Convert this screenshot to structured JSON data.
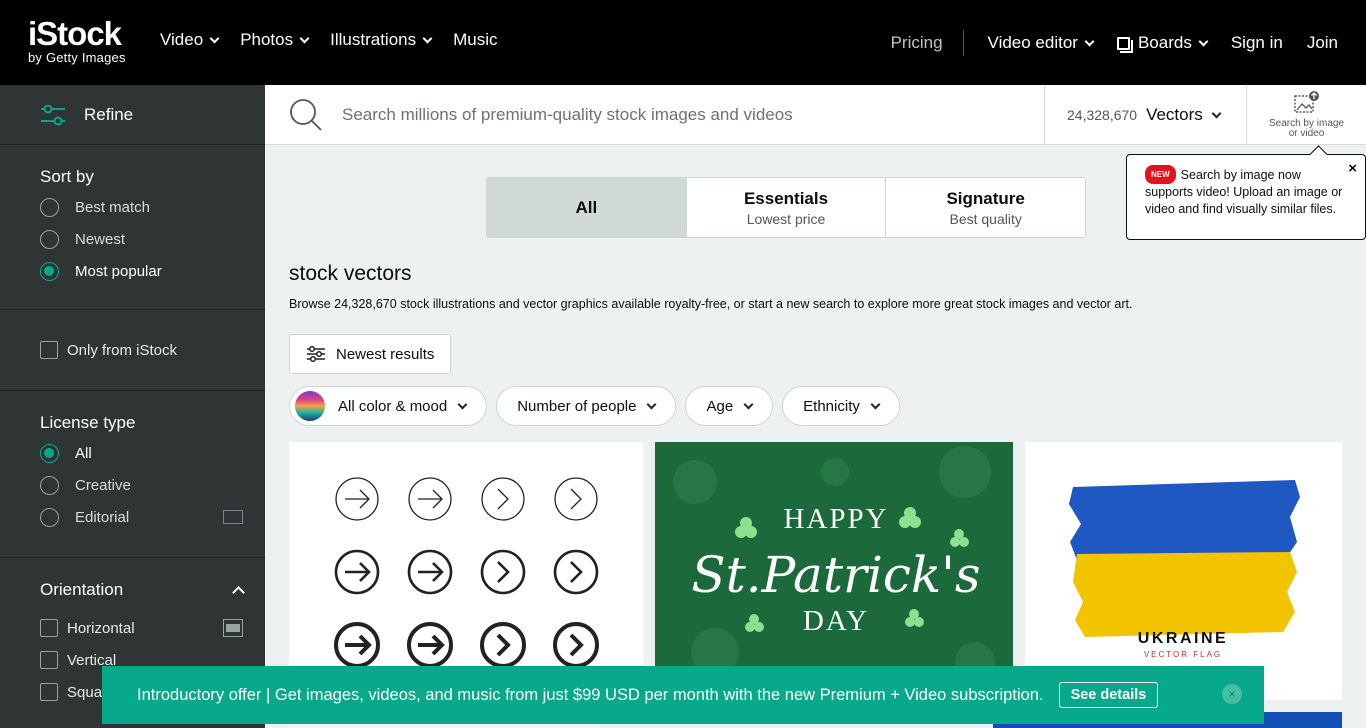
{
  "brand": {
    "name": "iStock",
    "sub": "by Getty Images"
  },
  "nav": {
    "video": "Video",
    "photos": "Photos",
    "illustrations": "Illustrations",
    "music": "Music",
    "pricing": "Pricing",
    "video_editor": "Video editor",
    "boards": "Boards",
    "sign_in": "Sign in",
    "join": "Join"
  },
  "search": {
    "placeholder": "Search millions of premium-quality stock images and videos",
    "value": "",
    "count": "24,328,670",
    "asset_type": "Vectors",
    "by_image_line1": "Search by image",
    "by_image_line2": "or video"
  },
  "tooltip": {
    "badge": "NEW",
    "text": "Search by image now supports video! Upload an image or video and find visually similar files.",
    "close": "×"
  },
  "sidebar": {
    "refine": "Refine",
    "sort_title": "Sort by",
    "sort": [
      "Best match",
      "Newest",
      "Most popular"
    ],
    "only_istock": "Only from iStock",
    "license_title": "License type",
    "license": [
      "All",
      "Creative",
      "Editorial"
    ],
    "orientation_title": "Orientation",
    "orientation": [
      "Horizontal",
      "Vertical",
      "Square"
    ]
  },
  "tabs": [
    {
      "title": "All",
      "subtitle": ""
    },
    {
      "title": "Essentials",
      "subtitle": "Lowest price"
    },
    {
      "title": "Signature",
      "subtitle": "Best quality"
    }
  ],
  "results": {
    "title": "stock vectors",
    "description": "Browse 24,328,670 stock illustrations and vector graphics available royalty-free, or start a new search to explore more great stock images and vector art.",
    "newest_button": "Newest results"
  },
  "filters": [
    "All color & mood",
    "Number of people",
    "Age",
    "Ethnicity"
  ],
  "images": {
    "patricks_line1": "HAPPY",
    "patricks_line2": "St.Patrick's",
    "patricks_line3": "DAY",
    "ukraine_title": "UKRAINE",
    "ukraine_sub": "VECTOR FLAG"
  },
  "promo": {
    "text": "Introductory offer | Get images, videos, and music from just $99 USD per month with the new Premium + Video subscription.",
    "button": "See details",
    "close": "×"
  },
  "colors": {
    "accent": "#08a88a",
    "nav_bg": "#000000",
    "sidebar_bg": "#2f3535",
    "page_bg": "#eef1f1"
  }
}
